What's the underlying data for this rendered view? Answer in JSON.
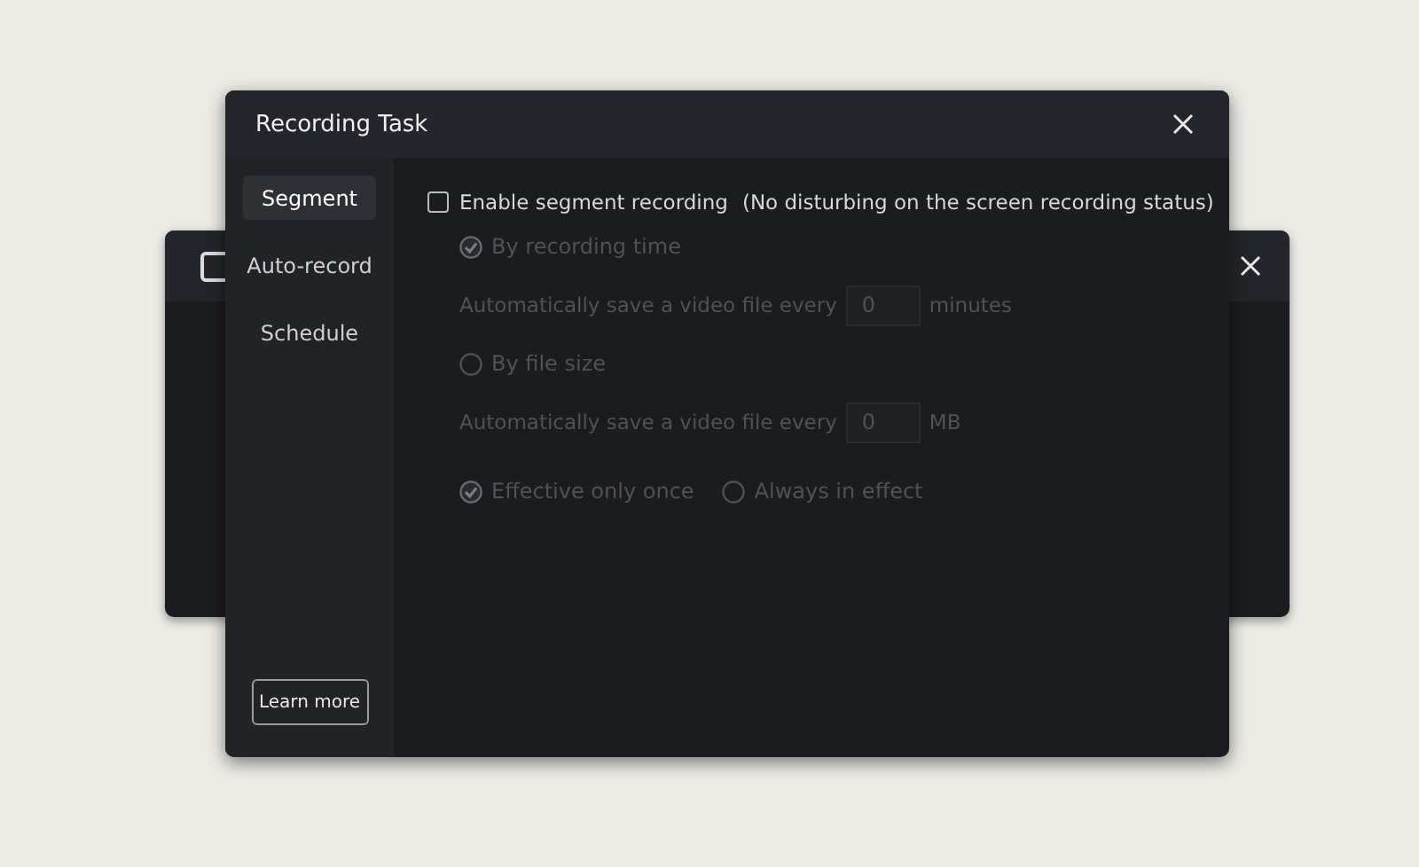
{
  "dialog": {
    "title": "Recording Task",
    "sidebar": {
      "items": [
        {
          "label": "Segment",
          "selected": true
        },
        {
          "label": "Auto-record",
          "selected": false
        },
        {
          "label": "Schedule",
          "selected": false
        }
      ],
      "learn_more": "Learn more"
    },
    "enable": {
      "label": "Enable segment recording",
      "note": "(No disturbing on the screen recording status)",
      "checked": false
    },
    "modes": [
      {
        "kind": "radio",
        "label": "By recording time",
        "selected": true,
        "disabled": true
      },
      {
        "kind": "field",
        "prefix": "Automatically save a video file every",
        "value": "0",
        "unit": "minutes",
        "disabled": true
      },
      {
        "kind": "radio",
        "label": "By file size",
        "selected": false,
        "disabled": true
      },
      {
        "kind": "field",
        "prefix": "Automatically save a video file every",
        "value": "0",
        "unit": "MB",
        "disabled": true
      }
    ],
    "effect": [
      {
        "label": "Effective only once",
        "selected": true,
        "disabled": true
      },
      {
        "label": "Always in effect",
        "selected": false,
        "disabled": true
      }
    ]
  }
}
